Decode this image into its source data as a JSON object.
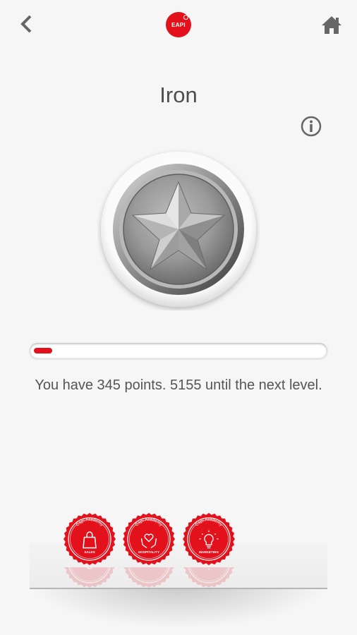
{
  "header": {
    "logo_text": "EAPI",
    "back_icon": "chevron-left-icon",
    "home_icon": "home-icon"
  },
  "level": {
    "title": "Iron",
    "info_icon": "info-icon",
    "medal_icon": "star-medal-icon"
  },
  "progress": {
    "fraction": 0.0627,
    "text": "You have 345 points. 5155 until the next level."
  },
  "badges": [
    {
      "arc_text": "Capi Academy",
      "label": "SALES",
      "icon": "shopping-bag-icon"
    },
    {
      "arc_text": "Capi Academy",
      "label": "HOSPITALITY",
      "icon": "heart-hands-icon"
    },
    {
      "arc_text": "Capi Academy",
      "label": "MARKETING",
      "icon": "lightbulb-icon"
    }
  ],
  "colors": {
    "brand_red": "#e3111b",
    "background": "#f6f6f6",
    "text": "#555555",
    "icon_gray": "#666666"
  }
}
